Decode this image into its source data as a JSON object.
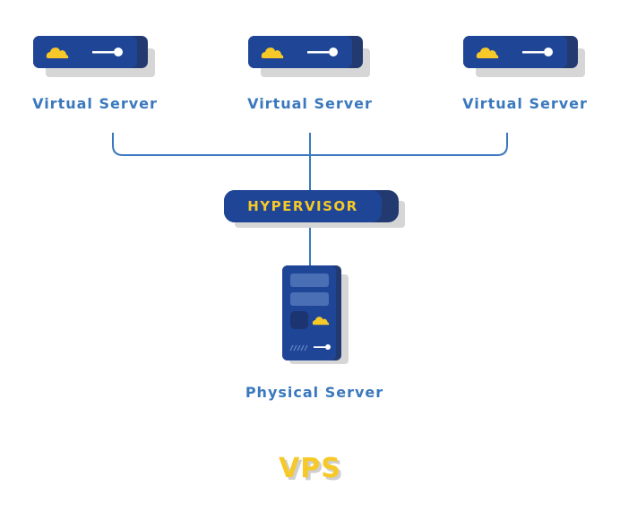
{
  "diagram": {
    "title": "VPS",
    "virtual_servers": [
      {
        "label": "Virtual Server",
        "icons": [
          "cloud-icon",
          "key-icon"
        ]
      },
      {
        "label": "Virtual Server",
        "icons": [
          "cloud-icon",
          "key-icon"
        ]
      },
      {
        "label": "Virtual Server",
        "icons": [
          "cloud-icon",
          "key-icon"
        ]
      }
    ],
    "hypervisor": {
      "label": "HYPERVISOR"
    },
    "physical_server": {
      "label": "Physical Server",
      "icons": [
        "cloud-icon",
        "key-icon",
        "vent-icon"
      ]
    },
    "connections": [
      {
        "from": "virtual_servers.0",
        "to": "hypervisor"
      },
      {
        "from": "virtual_servers.1",
        "to": "hypervisor"
      },
      {
        "from": "virtual_servers.2",
        "to": "hypervisor"
      },
      {
        "from": "hypervisor",
        "to": "physical_server"
      }
    ],
    "colors": {
      "primary": "#1f4596",
      "dark": "#233a70",
      "accent": "#f6c928",
      "line": "#3a78bd",
      "shadow": "#d6d6d6"
    }
  }
}
